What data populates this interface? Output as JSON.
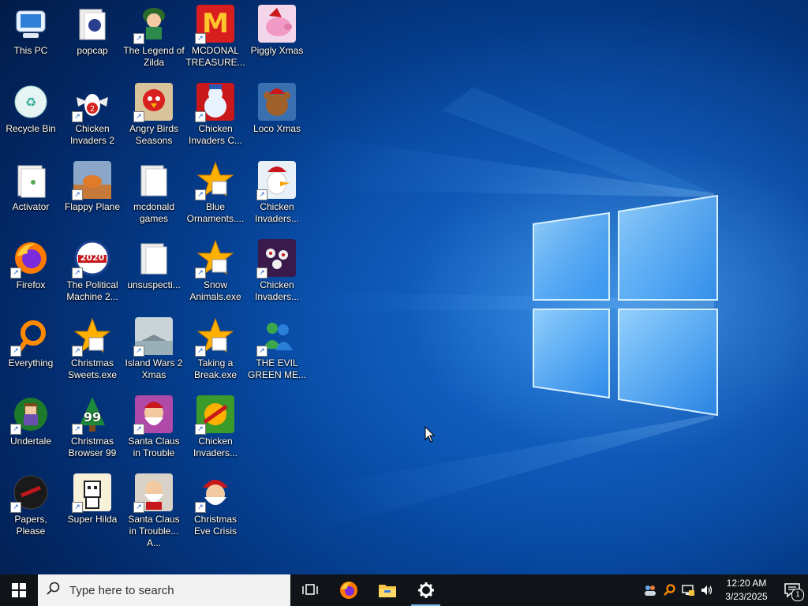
{
  "desktop": {
    "icons": [
      {
        "label": "This PC"
      },
      {
        "label": "popcap"
      },
      {
        "label": "The Legend of Zilda"
      },
      {
        "label": "MCDONAL TREASURE..."
      },
      {
        "label": "Piggly Xmas"
      },
      {
        "label": "Recycle Bin"
      },
      {
        "label": "Chicken Invaders 2"
      },
      {
        "label": "Angry Birds Seasons"
      },
      {
        "label": "Chicken Invaders C..."
      },
      {
        "label": "Loco Xmas"
      },
      {
        "label": "Activator"
      },
      {
        "label": "Flappy Plane"
      },
      {
        "label": "mcdonald games"
      },
      {
        "label": "Blue Ornaments...."
      },
      {
        "label": "Chicken Invaders..."
      },
      {
        "label": "Firefox"
      },
      {
        "label": "The Political Machine 2..."
      },
      {
        "label": "unsuspecti..."
      },
      {
        "label": "Snow Animals.exe"
      },
      {
        "label": "Chicken Invaders..."
      },
      {
        "label": "Everything"
      },
      {
        "label": "Christmas Sweets.exe"
      },
      {
        "label": "Island Wars 2 Xmas"
      },
      {
        "label": "Taking a Break.exe"
      },
      {
        "label": "THE EVIL GREEN ME..."
      },
      {
        "label": "Undertale"
      },
      {
        "label": "Christmas Browser 99"
      },
      {
        "label": "Santa Claus in Trouble"
      },
      {
        "label": "Chicken Invaders..."
      },
      {
        "label": "Papers, Please"
      },
      {
        "label": "Super Hilda"
      },
      {
        "label": "Santa Claus in Trouble... A..."
      },
      {
        "label": "Christmas Eve Crisis"
      }
    ],
    "mcdonalds_logo": "M",
    "political_badge": "2020",
    "browser_badge": "99"
  },
  "taskbar": {
    "search_placeholder": "Type here to search",
    "pinned": [
      {
        "name": "task-view-icon"
      },
      {
        "name": "firefox-icon"
      },
      {
        "name": "file-explorer-icon"
      },
      {
        "name": "settings-icon"
      }
    ],
    "clock": {
      "time": "12:20 AM",
      "date": "3/23/2025"
    },
    "notification_count": "1"
  },
  "colors": {
    "taskbar_bg": "#101419",
    "search_bg": "#f2f2f2",
    "active_indicator": "#76b9ed"
  }
}
